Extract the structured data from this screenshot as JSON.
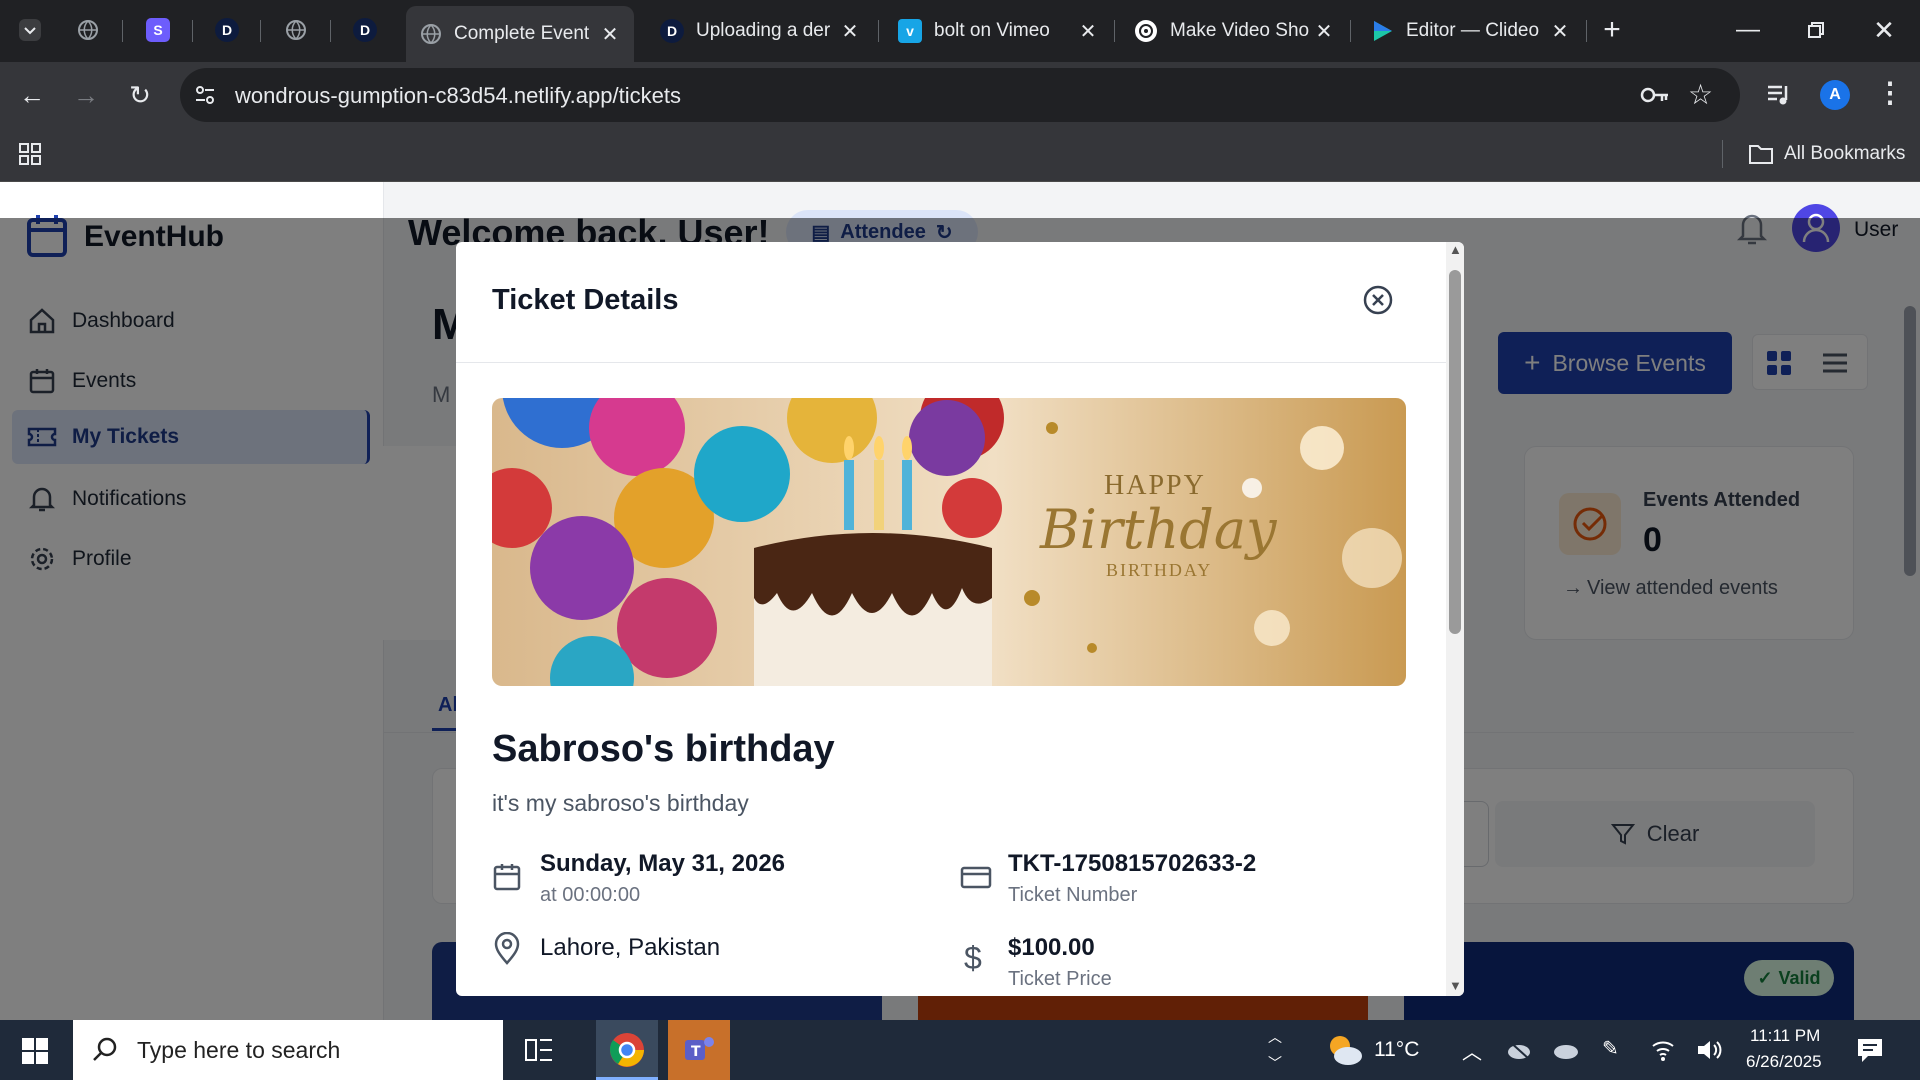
{
  "browser": {
    "tabs": [
      {
        "title": "Complete Event",
        "active": true
      },
      {
        "title": "Uploading a der",
        "active": false
      },
      {
        "title": "bolt on Vimeo",
        "active": false
      },
      {
        "title": "Make Video Sho",
        "active": false
      },
      {
        "title": "Editor — Clideo",
        "active": false
      }
    ],
    "small_tab_letters": [
      "S",
      "D",
      "D"
    ],
    "url": "wondrous-gumption-c83d54.netlify.app/tickets",
    "profile_initial": "A",
    "bookmarks_label": "All Bookmarks"
  },
  "app": {
    "brand": "EventHub",
    "welcome": "Welcome back, User!",
    "role_badge": "Attendee",
    "user_label": "User",
    "sidebar": [
      {
        "label": "Dashboard"
      },
      {
        "label": "Events"
      },
      {
        "label": "My Tickets"
      },
      {
        "label": "Notifications"
      },
      {
        "label": "Profile"
      }
    ],
    "page_title_fragment": "M",
    "page_sub_fragment": "M",
    "browse_events": "Browse Events",
    "stat": {
      "label": "Events Attended",
      "value": "0",
      "link": "View attended events"
    },
    "tab_fragment": "Al",
    "clear_label": "Clear",
    "valid_badge": "Valid"
  },
  "modal": {
    "title": "Ticket Details",
    "image_text_1": "HAPPY",
    "image_text_2": "Birthday",
    "image_text_3": "BIRTHDAY",
    "event_name": "Sabroso's birthday",
    "description": "it's my sabroso's birthday",
    "date": "Sunday, May 31, 2026",
    "time": "at 00:00:00",
    "location": "Lahore, Pakistan",
    "ticket_number": "TKT-1750815702633-2",
    "ticket_number_label": "Ticket Number",
    "price": "$100.00",
    "price_label": "Ticket Price"
  },
  "taskbar": {
    "search_placeholder": "Type here to search",
    "temperature": "11°C",
    "time": "11:11 PM",
    "date": "6/26/2025"
  },
  "colors": {
    "brand_blue": "#1e40af",
    "accent_orange": "#ea580c",
    "valid_green": "#15803d"
  }
}
